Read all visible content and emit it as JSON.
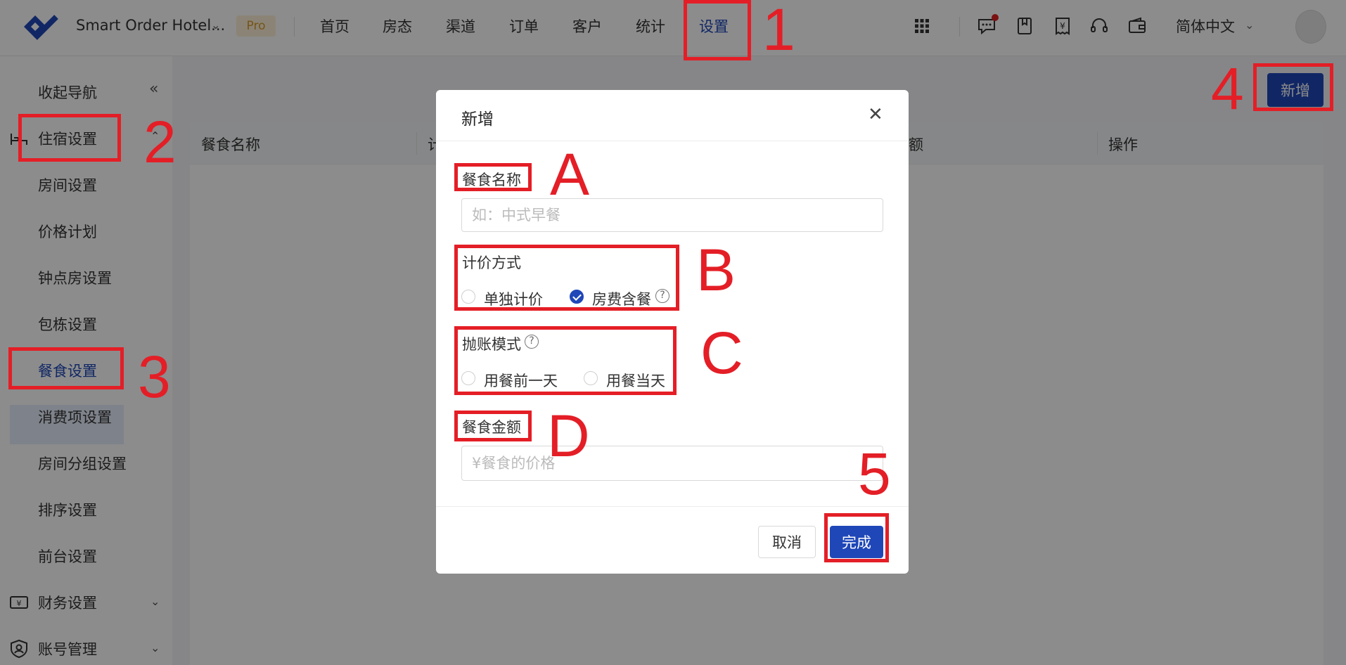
{
  "header": {
    "hotel_name": "Smart Order Hotel...",
    "badge": "Pro",
    "nav": [
      "首页",
      "房态",
      "渠道",
      "订单",
      "客户",
      "统计",
      "设置"
    ],
    "active_nav": "设置",
    "language": "简体中文",
    "icons": [
      "apps-grid-icon",
      "message-icon",
      "bookmark-icon",
      "invoice-icon",
      "headset-icon",
      "wallet-icon"
    ]
  },
  "sidebar": {
    "collapse_label": "收起导航",
    "group_lodging": "住宿设置",
    "items": [
      "房间设置",
      "价格计划",
      "钟点房设置",
      "包栋设置",
      "餐食设置",
      "消费项设置",
      "房间分组设置",
      "排序设置",
      "前台设置"
    ],
    "active_item": "餐食设置",
    "group_finance": "财务设置",
    "group_account": "账号管理"
  },
  "main": {
    "add_button": "新增",
    "columns": [
      "餐食名称",
      "计",
      "额",
      "操作"
    ]
  },
  "modal": {
    "title": "新增",
    "meal_name_label": "餐食名称",
    "meal_name_placeholder": "如：中式早餐",
    "pricing_label": "计价方式",
    "pricing_options": [
      "单独计价",
      "房费含餐"
    ],
    "pricing_selected": "房费含餐",
    "posting_label": "抛账模式",
    "posting_options": [
      "用餐前一天",
      "用餐当天"
    ],
    "amount_label": "餐食金额",
    "amount_placeholder": "¥餐食的价格",
    "cancel": "取消",
    "confirm": "完成"
  },
  "annotations": {
    "numbers": [
      "1",
      "2",
      "3",
      "4",
      "5"
    ],
    "letters": [
      "A",
      "B",
      "C",
      "D"
    ],
    "color": "#e41e26"
  },
  "colors": {
    "primary": "#1f47b8",
    "badge_bg": "#fdf1d8",
    "badge_text": "#d89a2b"
  }
}
